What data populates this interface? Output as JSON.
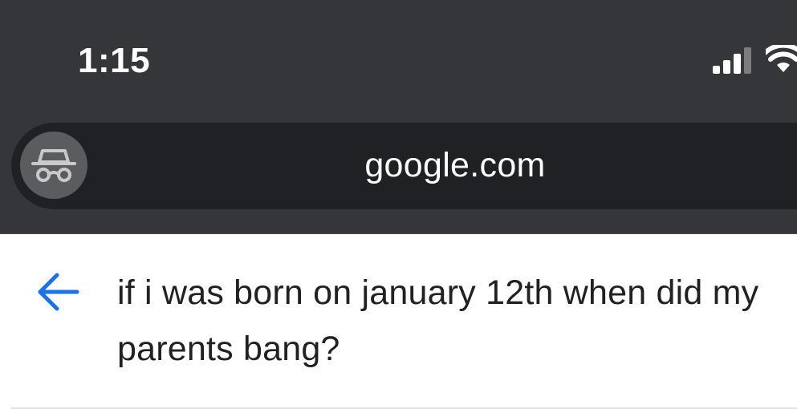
{
  "status_bar": {
    "time": "1:15",
    "icons": [
      "cellular-signal-icon",
      "wifi-icon"
    ]
  },
  "browser": {
    "mode_icon": "incognito-icon",
    "url": "google.com"
  },
  "search": {
    "back_icon": "back-arrow-icon",
    "query": "if i was born on january 12th when did my parents bang?"
  },
  "colors": {
    "chrome_background": "#34363a",
    "url_bar_background": "#202124",
    "incognito_button": "#5a5c60",
    "back_arrow": "#1a73e8",
    "query_text": "#202124"
  }
}
